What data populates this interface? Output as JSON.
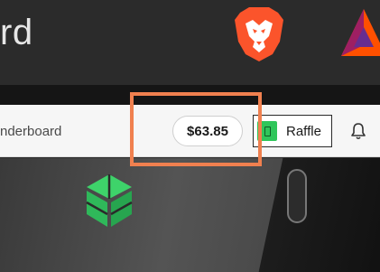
{
  "banner": {
    "title": "rd",
    "logos": [
      "brave-lion-logo",
      "bat-triangle-logo"
    ]
  },
  "toolbar": {
    "leaderboard_label": "nderboard",
    "balance": "$63.85",
    "raffle_label": "Raffle",
    "icons": [
      "raffle-ticket-icon",
      "bell-icon"
    ]
  },
  "colors": {
    "accent_highlight": "#f0804f",
    "brave_orange": "#fb542b",
    "raffle_green": "#2fc65a"
  }
}
